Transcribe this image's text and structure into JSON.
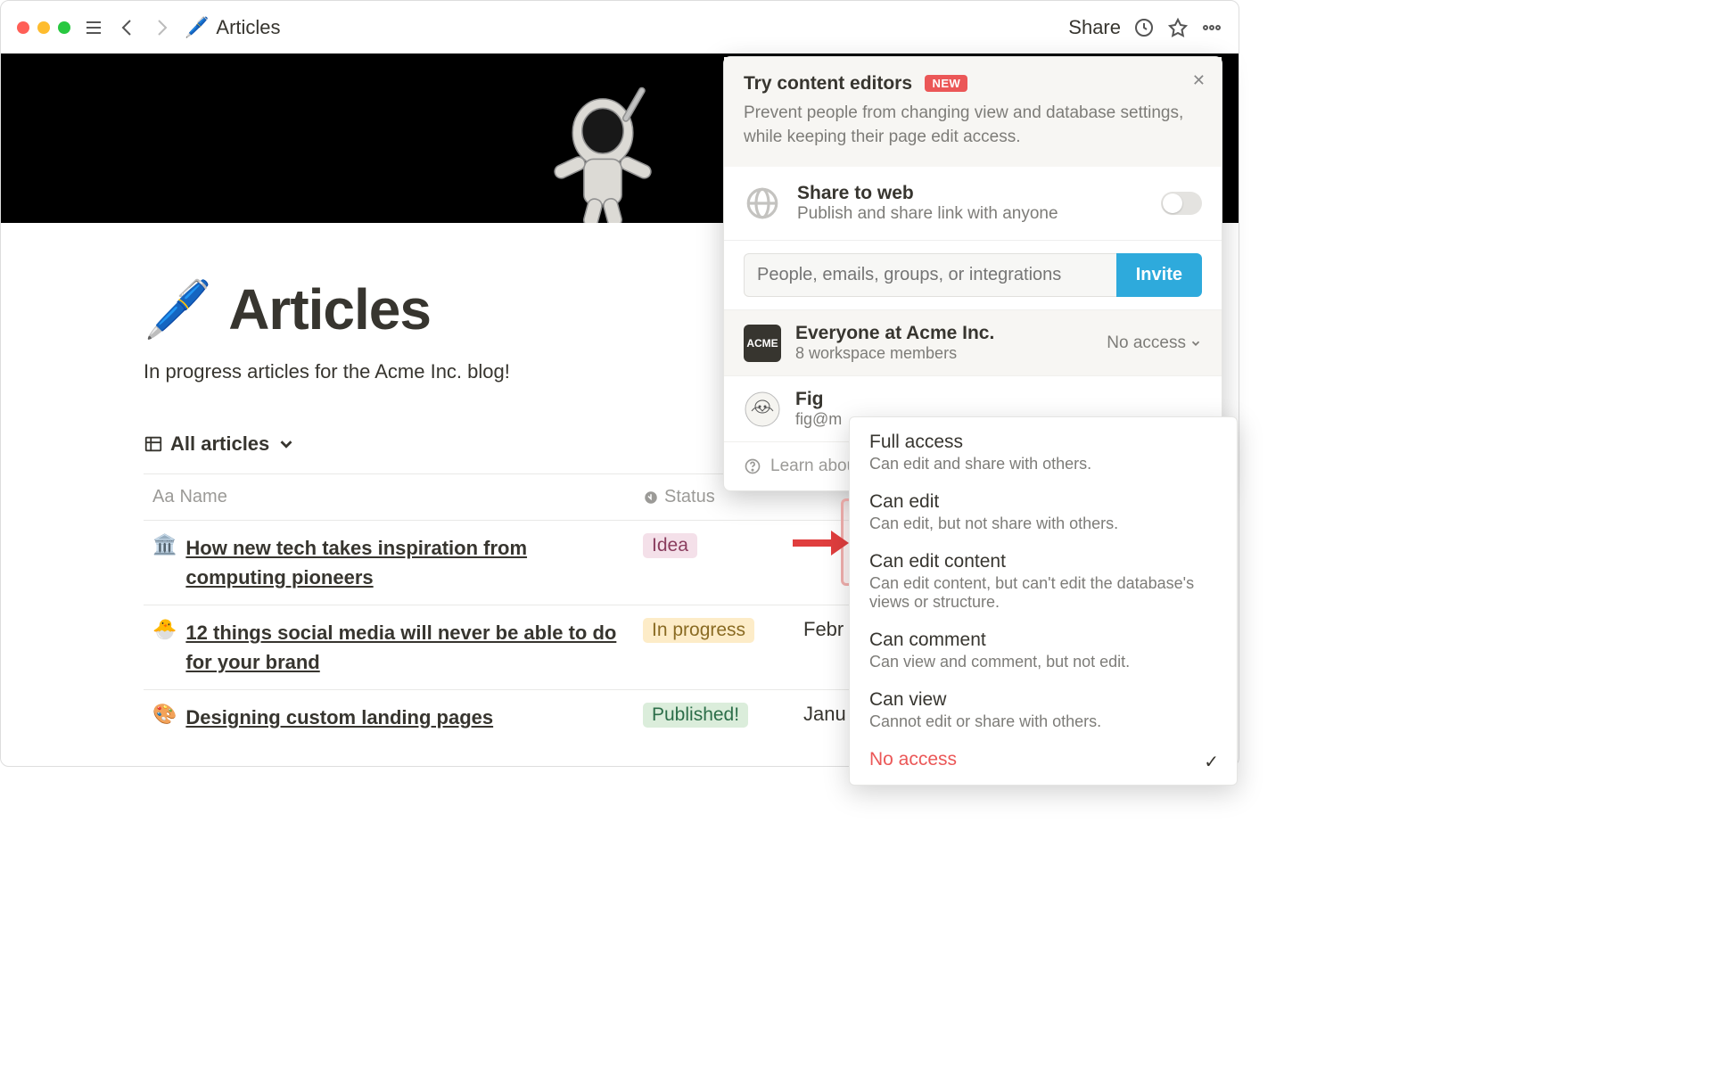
{
  "topbar": {
    "breadcrumb_icon": "🖊️",
    "breadcrumb_text": "Articles",
    "share_label": "Share"
  },
  "page": {
    "emoji": "🖊️",
    "title": "Articles",
    "description": "In progress articles for the Acme Inc. blog!",
    "view_label": "All articles"
  },
  "table": {
    "columns": {
      "name": "Name",
      "status": "Status"
    },
    "rows": [
      {
        "emoji": "🏛️",
        "title": "How new tech takes inspiration from computing pioneers",
        "status": "Idea",
        "status_class": "idea",
        "date": ""
      },
      {
        "emoji": "🐣",
        "title": "12 things social media will never be able to do for your brand",
        "status": "In progress",
        "status_class": "inprogress",
        "date": "Febr"
      },
      {
        "emoji": "🎨",
        "title": "Designing custom landing pages",
        "status": "Published!",
        "status_class": "published",
        "date": "Janu"
      }
    ]
  },
  "share_panel": {
    "promo_title": "Try content editors",
    "promo_badge": "NEW",
    "promo_desc": "Prevent people from changing view and database settings, while keeping their page edit access.",
    "web_title": "Share to web",
    "web_desc": "Publish and share link with anyone",
    "invite_placeholder": "People, emails, groups, or integrations",
    "invite_button": "Invite",
    "workspace": {
      "name": "Everyone at Acme Inc.",
      "sub": "8 workspace members",
      "access": "No access",
      "avatar_text": "ACME"
    },
    "user": {
      "name": "Fig",
      "sub": "fig@m"
    },
    "learn_label": "Learn abou"
  },
  "perm_menu": {
    "items": [
      {
        "title": "Full access",
        "desc": "Can edit and share with others."
      },
      {
        "title": "Can edit",
        "desc": "Can edit, but not share with others."
      },
      {
        "title": "Can edit content",
        "desc": "Can edit content, but can't edit the database's views or structure."
      },
      {
        "title": "Can comment",
        "desc": "Can view and comment, but not edit."
      },
      {
        "title": "Can view",
        "desc": "Cannot edit or share with others."
      },
      {
        "title": "No access",
        "desc": ""
      }
    ]
  }
}
